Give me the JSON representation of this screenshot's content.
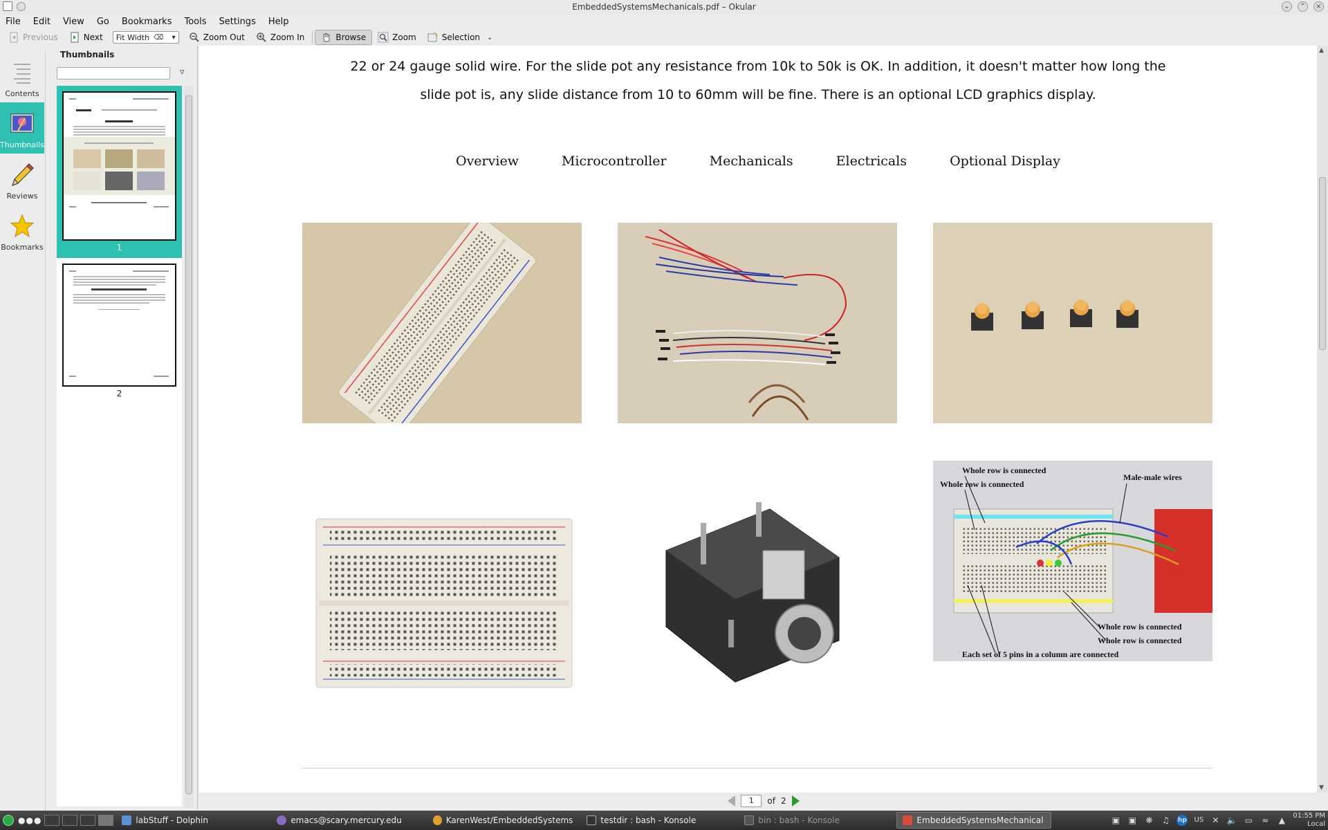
{
  "window": {
    "title": "EmbeddedSystemsMechanicals.pdf – Okular"
  },
  "menubar": {
    "items": [
      "File",
      "Edit",
      "View",
      "Go",
      "Bookmarks",
      "Tools",
      "Settings",
      "Help"
    ]
  },
  "toolbar": {
    "previous_label": "Previous",
    "next_label": "Next",
    "zoom_value": "Fit Width",
    "zoom_out_label": "Zoom Out",
    "zoom_in_label": "Zoom In",
    "browse_label": "Browse",
    "zoom_label": "Zoom",
    "selection_label": "Selection"
  },
  "sidebar": {
    "items": [
      {
        "label": "Contents",
        "icon": "contents-icon",
        "selected": false
      },
      {
        "label": "Thumbnails",
        "icon": "thumbnails-icon",
        "selected": true
      },
      {
        "label": "Reviews",
        "icon": "pencil-icon",
        "selected": false
      },
      {
        "label": "Bookmarks",
        "icon": "star-icon",
        "selected": false
      }
    ]
  },
  "thumbnails": {
    "title": "Thumbnails",
    "search_value": "",
    "pages": [
      {
        "number": "1",
        "selected": true
      },
      {
        "number": "2",
        "selected": false
      }
    ]
  },
  "document": {
    "line1": "22 or 24 gauge solid wire. For the slide pot any resistance from 10k to 50k is OK. In addition, it doesn't matter how long the",
    "line2": "slide pot is, any slide distance from 10 to 60mm will be fine. There is an optional LCD graphics display.",
    "nav": [
      "Overview",
      "Microcontroller",
      "Mechanicals",
      "Electricals",
      "Optional Display"
    ],
    "photo6_labels": {
      "a": "Whole row is connected",
      "b": "Whole row is connected",
      "c": "Male-male wires",
      "d": "Whole row is connected",
      "e": "Whole row is connected",
      "f": "Each set of 5 pins in a column are connected"
    }
  },
  "pagebar": {
    "current_page": "1",
    "of_label": "of",
    "total_pages": "2"
  },
  "taskbar": {
    "tasks": [
      {
        "label": "labStuff - Dolphin",
        "state": "normal",
        "color": "#5b8fd6"
      },
      {
        "label": "emacs@scary.mercury.edu",
        "state": "normal",
        "color": "#8a6bbd"
      },
      {
        "label": "KarenWest/EmbeddedSystems",
        "state": "normal",
        "color": "#e0a030"
      },
      {
        "label": "testdir : bash - Konsole",
        "state": "normal",
        "color": "#333333"
      },
      {
        "label": "bin : bash - Konsole",
        "state": "dim",
        "color": "#555555"
      },
      {
        "label": "EmbeddedSystemsMechanical",
        "state": "active",
        "color": "#d94a3a"
      }
    ],
    "tray_lang": "US",
    "clock_time": "01:55 PM",
    "clock_zone": "Local"
  },
  "colors": {
    "selection": "#2ec1b2",
    "next_arrow": "#2a9d2a"
  }
}
